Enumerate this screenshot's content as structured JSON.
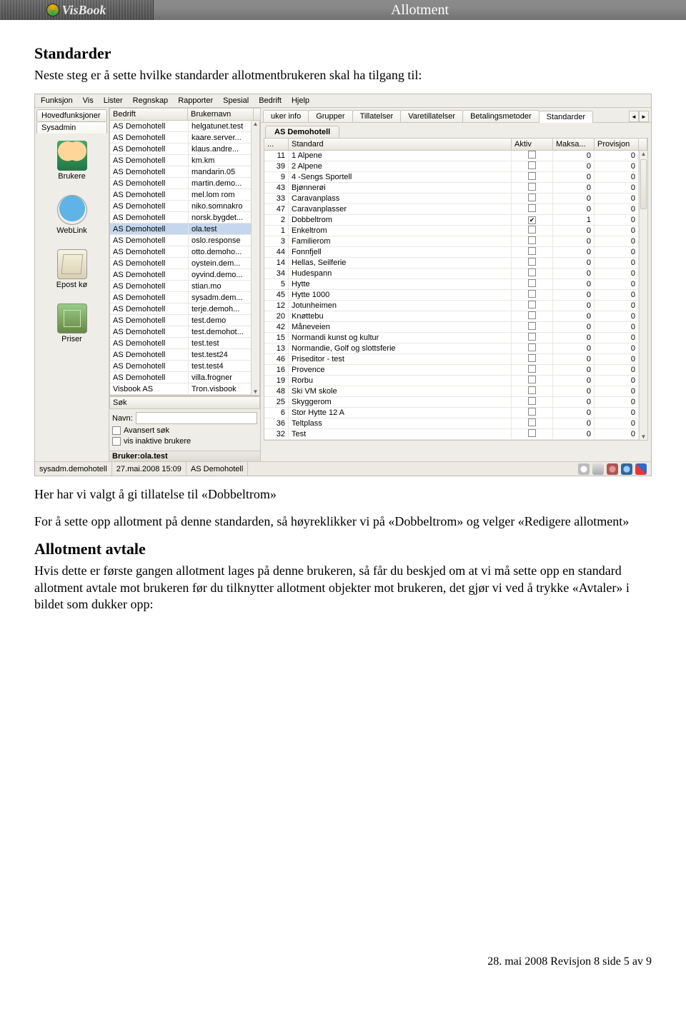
{
  "header": {
    "logo_text": "VisBook",
    "title": "Allotment"
  },
  "sections": {
    "h_standarder": "Standarder",
    "p_standarder": "Neste steg er å sette hvilke standarder allotmentbrukeren skal ha tilgang til:",
    "p_her": "Her har vi valgt å gi tillatelse til «Dobbeltrom»",
    "p_for": "For å sette opp allotment på denne standarden, så høyreklikker vi på «Dobbeltrom» og velger «Redigere allotment»",
    "h_avtale": "Allotment avtale",
    "p_avtale": "Hvis dette er første gangen allotment lages på denne brukeren, så får du beskjed om at vi må sette opp en standard allotment avtale mot brukeren før du tilknytter allotment objekter mot brukeren, det gjør vi ved å trykke «Avtaler» i bildet som dukker opp:"
  },
  "menubar": [
    "Funksjon",
    "Vis",
    "Lister",
    "Regnskap",
    "Rapporter",
    "Spesial",
    "Bedrift",
    "Hjelp"
  ],
  "left_tabs": {
    "a": "Hovedfunksjoner",
    "b": "Sysadmin"
  },
  "left_nav": [
    {
      "id": "brukere",
      "label": "Brukere",
      "icon": "ico-users"
    },
    {
      "id": "weblink",
      "label": "WebLink",
      "icon": "ico-globe"
    },
    {
      "id": "epostko",
      "label": "Epost kø",
      "icon": "ico-mail"
    },
    {
      "id": "priser",
      "label": "Priser",
      "icon": "ico-money"
    }
  ],
  "user_grid": {
    "headers": [
      "Bedrift",
      "Brukernavn"
    ],
    "selected_index": 9,
    "rows": [
      [
        "AS Demohotell",
        "helgatunet.test"
      ],
      [
        "AS Demohotell",
        "kaare.server..."
      ],
      [
        "AS Demohotell",
        "klaus.andre..."
      ],
      [
        "AS Demohotell",
        "km.km"
      ],
      [
        "AS Demohotell",
        "mandarin.05"
      ],
      [
        "AS Demohotell",
        "martin.demo..."
      ],
      [
        "AS Demohotell",
        "mel.lom rom"
      ],
      [
        "AS Demohotell",
        "niko.somnakro"
      ],
      [
        "AS Demohotell",
        "norsk.bygdet..."
      ],
      [
        "AS Demohotell",
        "ola.test"
      ],
      [
        "AS Demohotell",
        "oslo.response"
      ],
      [
        "AS Demohotell",
        "otto.demoho..."
      ],
      [
        "AS Demohotell",
        "oystein.dem..."
      ],
      [
        "AS Demohotell",
        "oyvind.demo..."
      ],
      [
        "AS Demohotell",
        "stian.mo"
      ],
      [
        "AS Demohotell",
        "sysadm.dem..."
      ],
      [
        "AS Demohotell",
        "terje.demoh..."
      ],
      [
        "AS Demohotell",
        "test.demo"
      ],
      [
        "AS Demohotell",
        "test.demohot..."
      ],
      [
        "AS Demohotell",
        "test.test"
      ],
      [
        "AS Demohotell",
        "test.test24"
      ],
      [
        "AS Demohotell",
        "test.test4"
      ],
      [
        "AS Demohotell",
        "villa.frogner"
      ],
      [
        "Visbook AS",
        "Tron.visbook"
      ]
    ]
  },
  "search": {
    "header": "Søk",
    "navn_label": "Navn:",
    "navn_value": "",
    "adv": "Avansert søk",
    "inactive": "vis inaktive brukere"
  },
  "bruker_line": "Bruker:ola.test",
  "top_tabs": [
    "uker info",
    "Grupper",
    "Tillatelser",
    "Varetillatelser",
    "Betalingsmetoder",
    "Standarder"
  ],
  "active_top_tab": 5,
  "sub_tab": "AS Demohotell",
  "std_grid": {
    "headers": [
      "...",
      "Standard",
      "Aktiv",
      "Maksa...",
      "Provisjon"
    ],
    "rows": [
      {
        "id": 11,
        "name": "1 Alpene",
        "aktiv": false,
        "maks": 0,
        "prov": 0
      },
      {
        "id": 39,
        "name": "2 Alpene",
        "aktiv": false,
        "maks": 0,
        "prov": 0
      },
      {
        "id": 9,
        "name": "4 -Sengs Sportell",
        "aktiv": false,
        "maks": 0,
        "prov": 0
      },
      {
        "id": 43,
        "name": "Bjønnerøi",
        "aktiv": false,
        "maks": 0,
        "prov": 0
      },
      {
        "id": 33,
        "name": "Caravanplass",
        "aktiv": false,
        "maks": 0,
        "prov": 0
      },
      {
        "id": 47,
        "name": "Caravanplasser",
        "aktiv": false,
        "maks": 0,
        "prov": 0
      },
      {
        "id": 2,
        "name": "Dobbeltrom",
        "aktiv": true,
        "maks": 1,
        "prov": 0
      },
      {
        "id": 1,
        "name": "Enkeltrom",
        "aktiv": false,
        "maks": 0,
        "prov": 0
      },
      {
        "id": 3,
        "name": "Familierom",
        "aktiv": false,
        "maks": 0,
        "prov": 0
      },
      {
        "id": 44,
        "name": "Fonnfjell",
        "aktiv": false,
        "maks": 0,
        "prov": 0
      },
      {
        "id": 14,
        "name": "Hellas, Seilferie",
        "aktiv": false,
        "maks": 0,
        "prov": 0
      },
      {
        "id": 34,
        "name": "Hudespann",
        "aktiv": false,
        "maks": 0,
        "prov": 0
      },
      {
        "id": 5,
        "name": "Hytte",
        "aktiv": false,
        "maks": 0,
        "prov": 0
      },
      {
        "id": 45,
        "name": "Hytte 1000",
        "aktiv": false,
        "maks": 0,
        "prov": 0
      },
      {
        "id": 12,
        "name": "Jotunheimen",
        "aktiv": false,
        "maks": 0,
        "prov": 0
      },
      {
        "id": 20,
        "name": "Knøttebu",
        "aktiv": false,
        "maks": 0,
        "prov": 0
      },
      {
        "id": 42,
        "name": "Måneveien",
        "aktiv": false,
        "maks": 0,
        "prov": 0
      },
      {
        "id": 15,
        "name": "Normandi kunst og kultur",
        "aktiv": false,
        "maks": 0,
        "prov": 0
      },
      {
        "id": 13,
        "name": "Normandie, Golf og slottsferie",
        "aktiv": false,
        "maks": 0,
        "prov": 0
      },
      {
        "id": 46,
        "name": "Priseditor - test",
        "aktiv": false,
        "maks": 0,
        "prov": 0
      },
      {
        "id": 16,
        "name": "Provence",
        "aktiv": false,
        "maks": 0,
        "prov": 0
      },
      {
        "id": 19,
        "name": "Rorbu",
        "aktiv": false,
        "maks": 0,
        "prov": 0
      },
      {
        "id": 48,
        "name": "Ski VM skole",
        "aktiv": false,
        "maks": 0,
        "prov": 0
      },
      {
        "id": 25,
        "name": "Skyggerom",
        "aktiv": false,
        "maks": 0,
        "prov": 0
      },
      {
        "id": 6,
        "name": "Stor Hytte 12 A",
        "aktiv": false,
        "maks": 0,
        "prov": 0
      },
      {
        "id": 36,
        "name": "Teltplass",
        "aktiv": false,
        "maks": 0,
        "prov": 0
      },
      {
        "id": 32,
        "name": "Test",
        "aktiv": false,
        "maks": 0,
        "prov": 0
      }
    ]
  },
  "statusbar": {
    "user": "sysadm.demohotell",
    "date": "27.mai.2008 15:09",
    "company": "AS Demohotell"
  },
  "footer": "28. mai 2008 Revisjon 8      side 5 av 9"
}
